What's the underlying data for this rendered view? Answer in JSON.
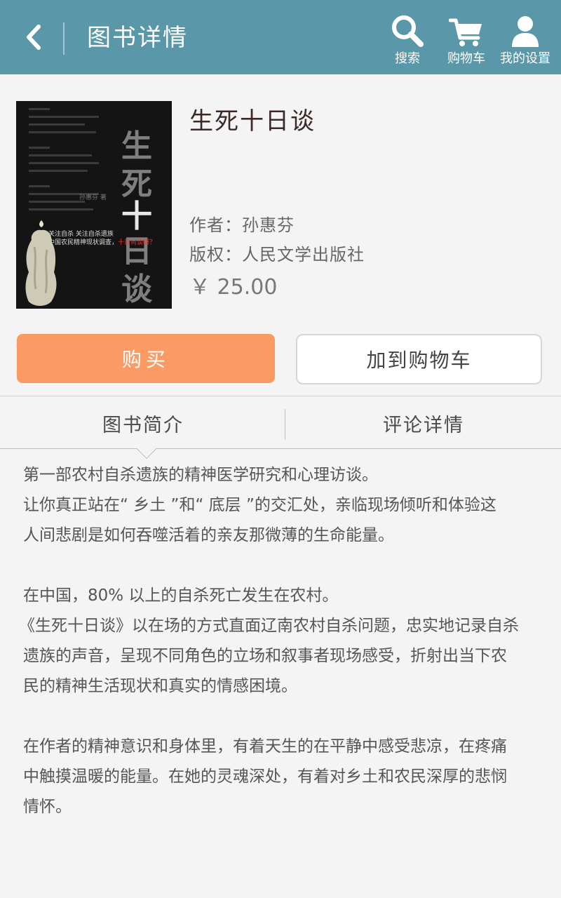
{
  "header": {
    "title": "图书详情",
    "actions": [
      {
        "label": "搜索",
        "icon": "search-icon"
      },
      {
        "label": "购物车",
        "icon": "cart-icon"
      },
      {
        "label": "我的设置",
        "icon": "user-icon"
      }
    ],
    "back_icon": "chevron-left-icon",
    "bg_color": "#5a97a8"
  },
  "book": {
    "title": "生死十日谈",
    "author_line": "作者：孙惠芬",
    "publisher_line": "版权：人民文学出版社",
    "price": "￥ 25.00",
    "cover": {
      "title_chars": [
        "生",
        "死",
        "十",
        "日",
        "谈"
      ],
      "author_mini": "孙惠芬 著",
      "tagline_1": "关注自杀  关注自杀遗族",
      "tagline_2": "中国农民精神现状调查，",
      "tagline_red": "十日何谈呀？"
    }
  },
  "buttons": {
    "buy_label": "购买",
    "add_cart_label": "加到购物车",
    "buy_color": "#fc9a64"
  },
  "tabs": {
    "intro_label": "图书简介",
    "reviews_label": "评论详情",
    "active": "图书简介"
  },
  "intro": {
    "p1_l1": "第一部农村自杀遗族的精神医学研究和心理访谈。",
    "p1_l2": "让你真正站在“ 乡土 ”和“ 底层 ”的交汇处，亲临现场倾听和体验这",
    "p1_l3": "人间悲剧是如何吞噬活着的亲友那微薄的生命能量。",
    "p2_l1": "在中国，80% 以上的自杀死亡发生在农村。",
    "p2_l2": "《生死十日谈》以在场的方式直面辽南农村自杀问题，忠实地记录自杀",
    "p2_l3": "遗族的声音，呈现不同角色的立场和叙事者现场感受，折射出当下农",
    "p2_l4": "民的精神生活现状和真实的情感困境。",
    "p3_l1": "在作者的精神意识和身体里，有着天生的在平静中感受悲凉，在疼痛",
    "p3_l2": "中触摸温暖的能量。在她的灵魂深处，有着对乡土和农民深厚的悲悯",
    "p3_l3": "情怀。"
  }
}
